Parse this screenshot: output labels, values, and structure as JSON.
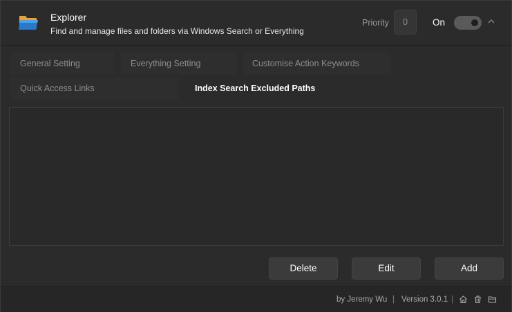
{
  "header": {
    "title": "Explorer",
    "subtitle": "Find and manage files and folders via Windows Search or Everything",
    "priority_label": "Priority",
    "priority_value": "0",
    "toggle_label": "On",
    "toggle_state": "on"
  },
  "tabs": [
    {
      "label": "General Setting"
    },
    {
      "label": "Everything Setting"
    },
    {
      "label": "Customise Action Keywords"
    },
    {
      "label": "Quick Access Links"
    },
    {
      "label": "Index Search Excluded Paths"
    }
  ],
  "active_tab": "Index Search Excluded Paths",
  "buttons": {
    "delete": "Delete",
    "edit": "Edit",
    "add": "Add"
  },
  "footer": {
    "author": "by  Jeremy Wu",
    "separator": "|",
    "version": "Version 3.0.1",
    "icons": [
      "home-icon",
      "trash-icon",
      "folder-icon"
    ]
  },
  "colors": {
    "background": "#2b2b2b",
    "accent_text": "#ffffff",
    "muted_text": "#8e8e8e"
  }
}
